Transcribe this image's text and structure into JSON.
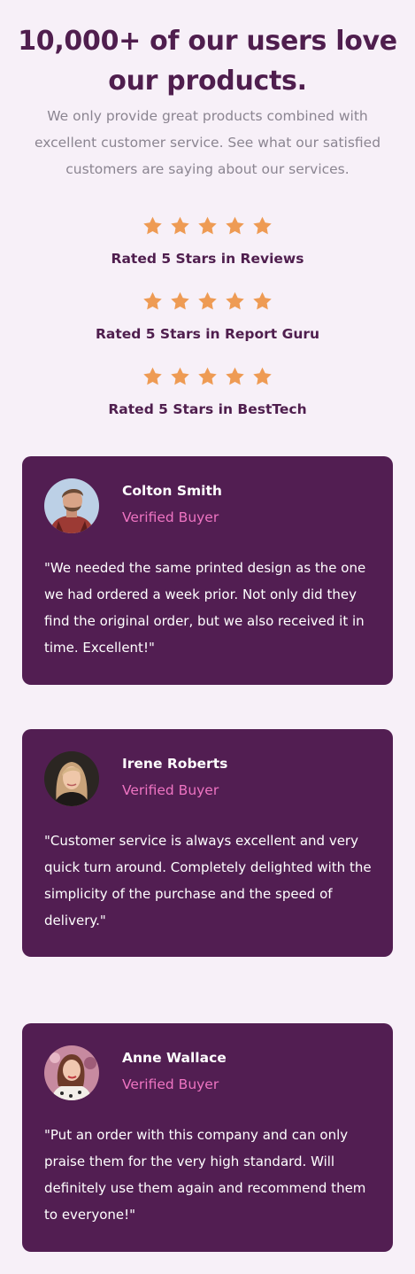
{
  "header": {
    "title": "10,000+ of our users love our products.",
    "description": "We only provide great products combined with excellent customer service. See what our satisfied customers are saying about our services."
  },
  "colors": {
    "background": "#f7f0f8",
    "primary": "#4f1e4e",
    "card": "#521e52",
    "star": "#ee9b54",
    "accent": "#ee74c2",
    "muted": "#8b8591"
  },
  "ratings": [
    {
      "stars": 5,
      "label": "Rated 5 Stars in Reviews"
    },
    {
      "stars": 5,
      "label": "Rated 5 Stars in Report Guru"
    },
    {
      "stars": 5,
      "label": "Rated 5 Stars in BestTech"
    }
  ],
  "testimonials": [
    {
      "name": "Colton Smith",
      "status": "Verified Buyer",
      "quote": "\"We needed the same printed design as the one we had ordered a week prior. Not only did they find the original order, but we also received it in time. Excellent!\""
    },
    {
      "name": "Irene Roberts",
      "status": "Verified Buyer",
      "quote": "\"Customer service is always excellent and very quick turn around. Completely delighted with the simplicity of the purchase and the speed of delivery.\""
    },
    {
      "name": "Anne Wallace",
      "status": "Verified Buyer",
      "quote": "\"Put an order with this company and can only praise them for the very high standard. Will definitely use them again and recommend them to everyone!\""
    }
  ]
}
